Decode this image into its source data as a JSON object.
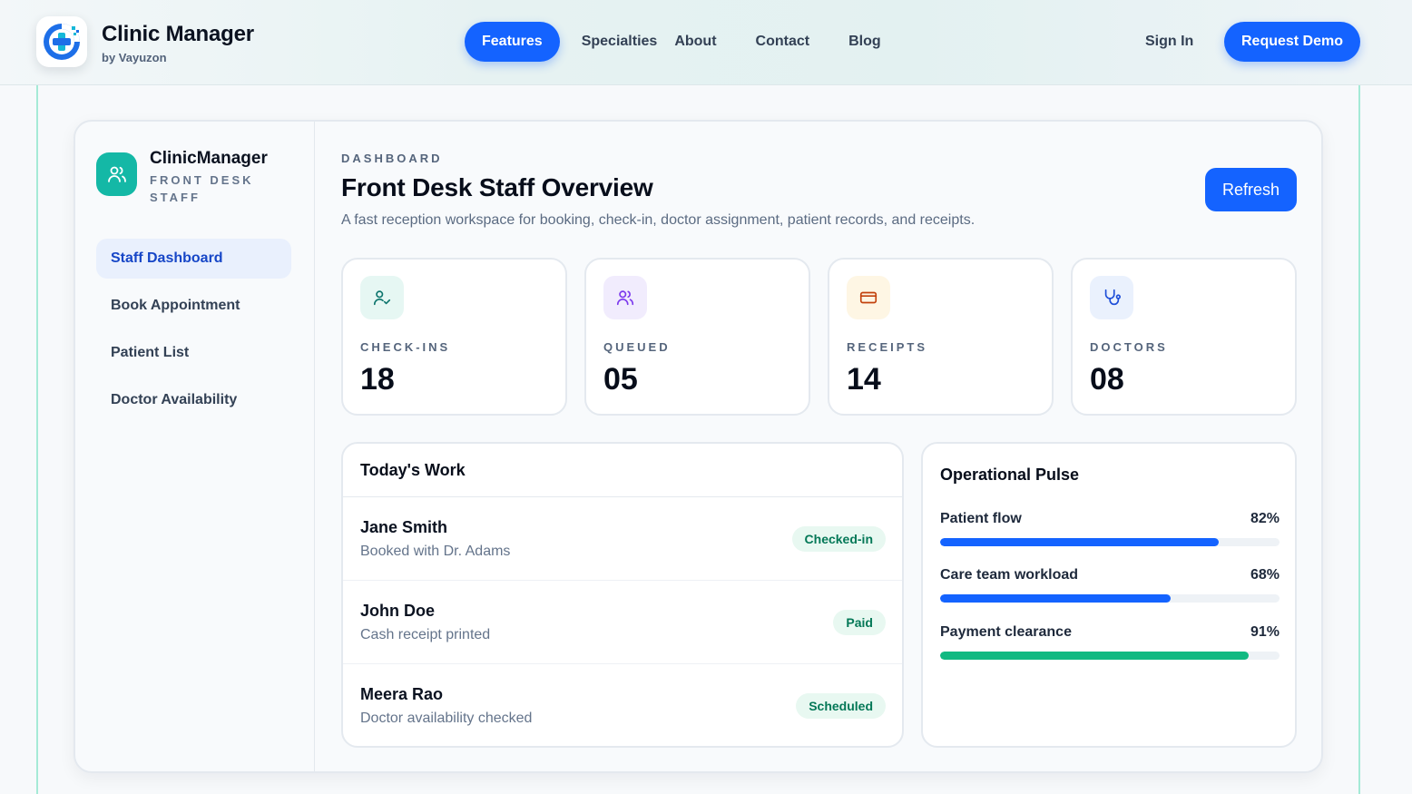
{
  "header": {
    "brand_title": "Clinic Manager",
    "brand_sub": "by Vayuzon",
    "nav": [
      {
        "label": "Features",
        "active": true
      },
      {
        "label": "Specialties",
        "active": false
      },
      {
        "label": "About",
        "active": false
      },
      {
        "label": "Contact",
        "active": false
      },
      {
        "label": "Blog",
        "active": false
      }
    ],
    "sign_in": "Sign In",
    "request_demo": "Request Demo"
  },
  "sidebar": {
    "title": "ClinicManager",
    "role": "FRONT DESK STAFF",
    "items": [
      {
        "label": "Staff Dashboard",
        "active": true
      },
      {
        "label": "Book Appointment",
        "active": false
      },
      {
        "label": "Patient List",
        "active": false
      },
      {
        "label": "Doctor Availability",
        "active": false
      }
    ]
  },
  "main": {
    "eyebrow": "DASHBOARD",
    "title": "Front Desk Staff Overview",
    "description": "A fast reception workspace for booking, check-in, doctor assignment, patient records, and receipts.",
    "refresh": "Refresh",
    "stats": [
      {
        "label": "CHECK-INS",
        "value": "18",
        "icon": "user-check-icon",
        "color": "#0f766e",
        "bg": "#e6f7f3"
      },
      {
        "label": "QUEUED",
        "value": "05",
        "icon": "users-icon",
        "color": "#7c3aed",
        "bg": "#f1ecfd"
      },
      {
        "label": "RECEIPTS",
        "value": "14",
        "icon": "credit-card-icon",
        "color": "#c2410c",
        "bg": "#fef6e4"
      },
      {
        "label": "DOCTORS",
        "value": "08",
        "icon": "stethoscope-icon",
        "color": "#1d4ed8",
        "bg": "#eaf1fd"
      }
    ]
  },
  "work": {
    "title": "Today's Work",
    "rows": [
      {
        "name": "Jane Smith",
        "sub": "Booked with Dr. Adams",
        "status": "Checked-in"
      },
      {
        "name": "John Doe",
        "sub": "Cash receipt printed",
        "status": "Paid"
      },
      {
        "name": "Meera Rao",
        "sub": "Doctor availability checked",
        "status": "Scheduled"
      }
    ]
  },
  "pulse": {
    "title": "Operational Pulse",
    "metrics": [
      {
        "label": "Patient flow",
        "pct_text": "82%",
        "value": 0.82,
        "color": "#1463ff"
      },
      {
        "label": "Care team workload",
        "pct_text": "68%",
        "value": 0.68,
        "color": "#1463ff"
      },
      {
        "label": "Payment clearance",
        "pct_text": "91%",
        "value": 0.91,
        "color": "#10b981"
      }
    ]
  },
  "colors": {
    "primary": "#1463ff",
    "teal": "#14b8a6",
    "success": "#10b981"
  }
}
